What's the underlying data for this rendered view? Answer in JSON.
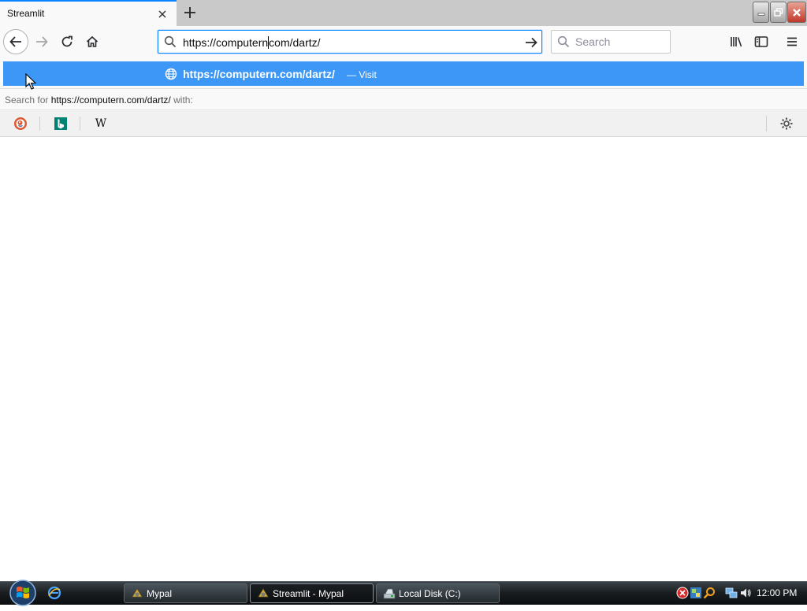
{
  "window": {
    "tab_title": "Streamlit"
  },
  "navbar": {
    "url_before_caret": "https://computern",
    "url_after_caret": "com/dartz/",
    "search_placeholder": "Search"
  },
  "popup": {
    "suggestion_url": "https://computern.com/dartz/",
    "suggestion_action": "— Visit",
    "search_for_prefix": "Search for",
    "search_for_query": "https://computern.com/dartz/",
    "search_for_suffix": "with:",
    "engines": [
      "duckduckgo-icon",
      "bing-icon",
      "wikipedia-icon"
    ],
    "wiki_glyph": "W"
  },
  "taskbar": {
    "buttons": [
      {
        "label": "Mypal",
        "active": false
      },
      {
        "label": "Streamlit - Mypal",
        "active": true
      },
      {
        "label": "Local Disk (C:)",
        "active": false
      }
    ],
    "clock": "12:00 PM"
  },
  "colors": {
    "accent": "#0a84ff",
    "highlight_row": "#3c97f6"
  }
}
